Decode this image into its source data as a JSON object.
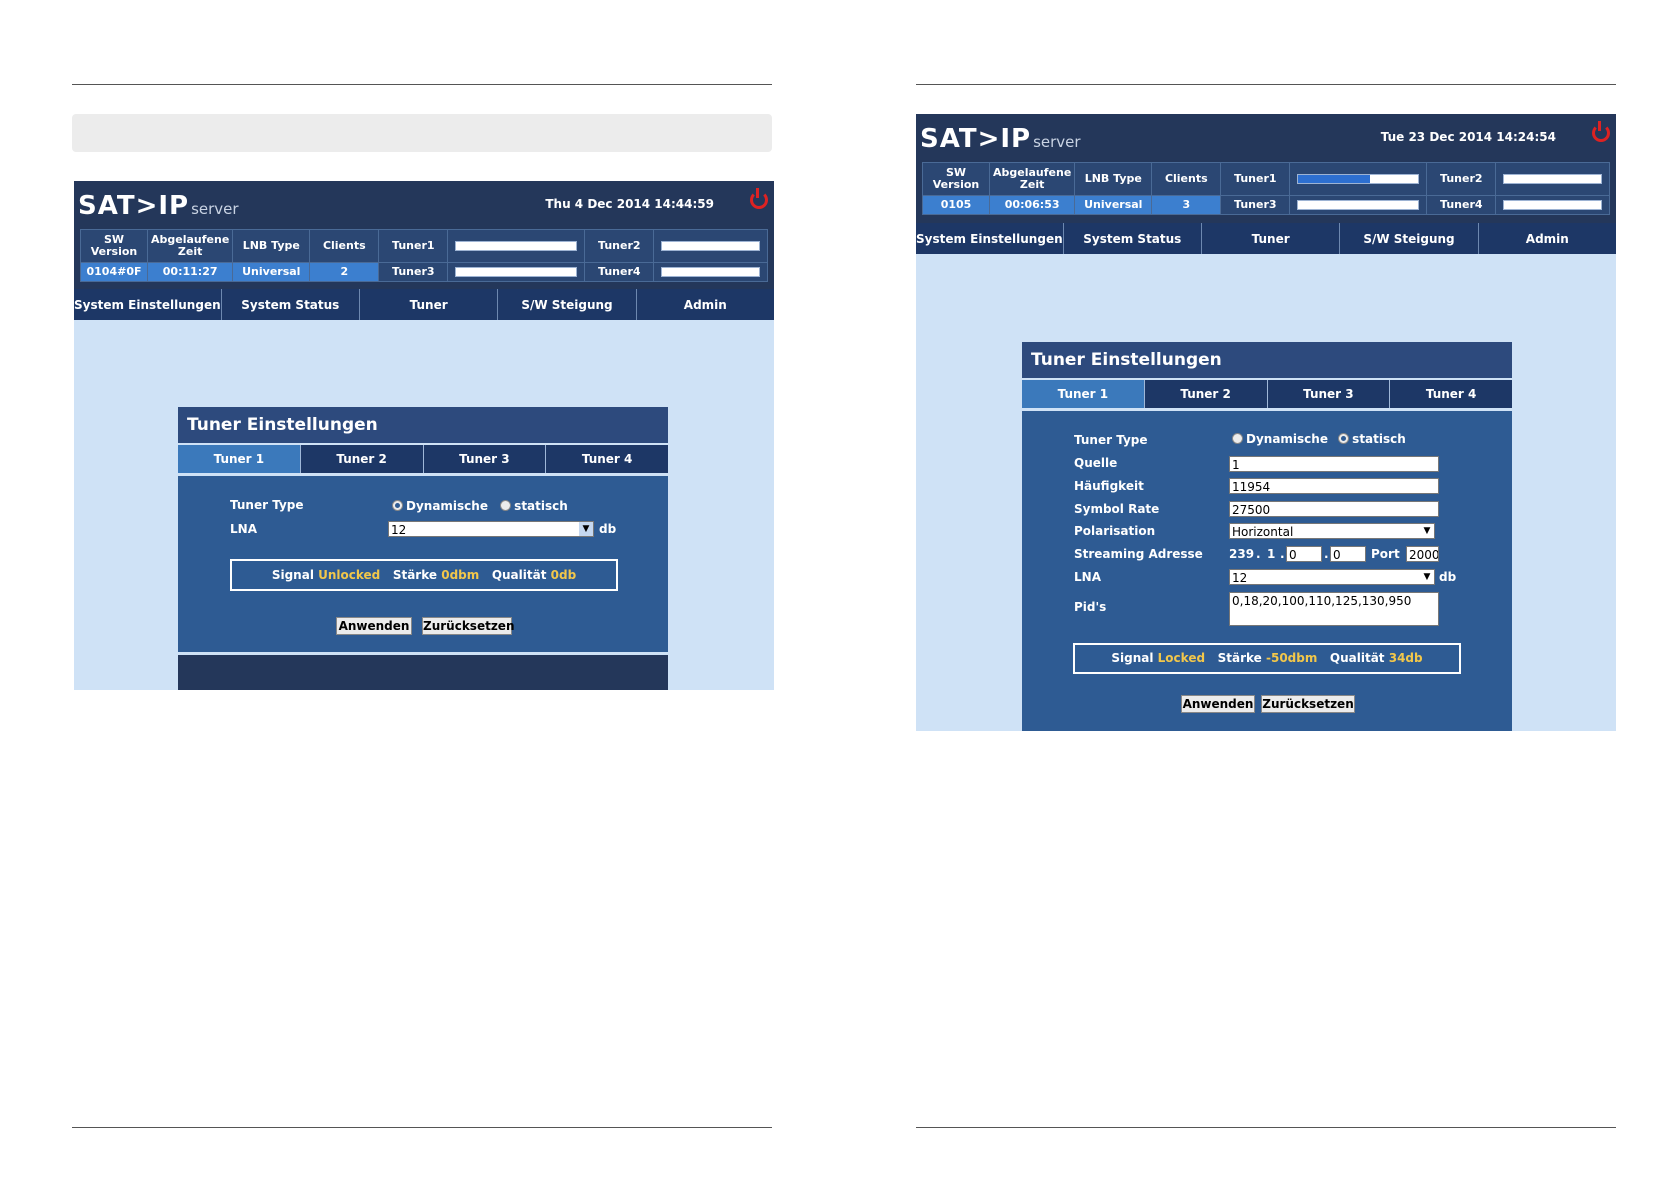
{
  "left": {
    "logo": "SAT>IP",
    "logo_suffix": "server",
    "datetime": "Thu 4 Dec 2014 14:44:59",
    "status": {
      "sw_version_label": "SW Version",
      "elapsed_label": "Abgelaufene Zeit",
      "lnb_label": "LNB Type",
      "clients_label": "Clients",
      "sw_version": "0104#0F",
      "elapsed": "00:11:27",
      "lnb": "Universal",
      "clients": "2",
      "tuner1": "Tuner1",
      "tuner2": "Tuner2",
      "tuner3": "Tuner3",
      "tuner4": "Tuner4"
    },
    "nav": [
      "System Einstellungen",
      "System Status",
      "Tuner",
      "S/W Steigung",
      "Admin"
    ],
    "panel": {
      "title": "Tuner Einstellungen",
      "tabs": [
        "Tuner 1",
        "Tuner 2",
        "Tuner 3",
        "Tuner 4"
      ],
      "tuner_type_label": "Tuner Type",
      "opt_dynamic": "Dynamische",
      "opt_static": "statisch",
      "selected": "Dynamische",
      "lna_label": "LNA",
      "lna_value": "12",
      "lna_unit": "db",
      "signal_label": "Signal",
      "signal_state": "Unlocked",
      "strength_label": "Stärke",
      "strength_value": "0dbm",
      "quality_label": "Qualität",
      "quality_value": "0db",
      "apply": "Anwenden",
      "reset": "Zurücksetzen"
    }
  },
  "right": {
    "logo": "SAT>IP",
    "logo_suffix": "server",
    "datetime": "Tue 23 Dec 2014 14:24:54",
    "status": {
      "sw_version_label": "SW Version",
      "elapsed_label": "Abgelaufene Zeit",
      "lnb_label": "LNB Type",
      "clients_label": "Clients",
      "sw_version": "0105",
      "elapsed": "00:06:53",
      "lnb": "Universal",
      "clients": "3",
      "tuner1": "Tuner1",
      "tuner2": "Tuner2",
      "tuner3": "Tuner3",
      "tuner4": "Tuner4",
      "tuner1_signal_fraction": 0.6
    },
    "nav": [
      "System Einstellungen",
      "System Status",
      "Tuner",
      "S/W Steigung",
      "Admin"
    ],
    "panel": {
      "title": "Tuner Einstellungen",
      "tabs": [
        "Tuner 1",
        "Tuner 2",
        "Tuner 3",
        "Tuner 4"
      ],
      "tuner_type_label": "Tuner Type",
      "opt_dynamic": "Dynamische",
      "opt_static": "statisch",
      "selected": "statisch",
      "source_label": "Quelle",
      "source_value": "1",
      "freq_label": "Häufigkeit",
      "freq_value": "11954",
      "symbol_label": "Symbol Rate",
      "symbol_value": "27500",
      "pol_label": "Polarisation",
      "pol_value": "Horizontal",
      "stream_label": "Streaming Adresse",
      "stream_a": "239",
      "stream_b": "1",
      "stream_c": "0",
      "stream_d": "0",
      "port_label": "Port",
      "port_value": "2000",
      "lna_label": "LNA",
      "lna_value": "12",
      "lna_unit": "db",
      "pids_label": "Pid's",
      "pids_value": "0,18,20,100,110,125,130,950",
      "signal_label": "Signal",
      "signal_state": "Locked",
      "strength_label": "Stärke",
      "strength_value": "-50dbm",
      "quality_label": "Qualität",
      "quality_value": "34db",
      "apply": "Anwenden",
      "reset": "Zurücksetzen"
    }
  }
}
